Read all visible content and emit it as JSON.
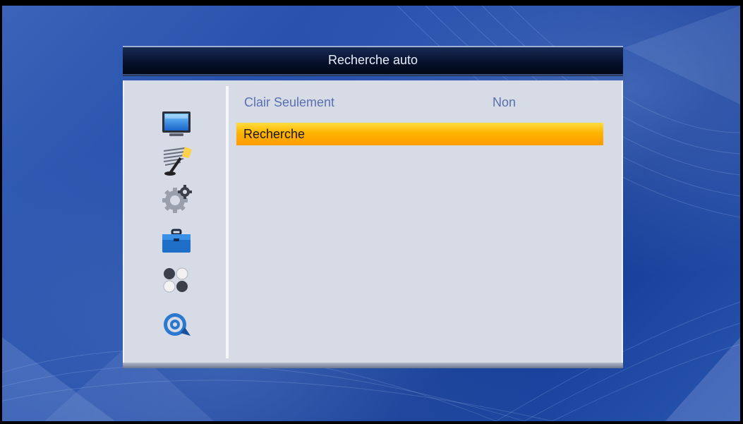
{
  "dialog": {
    "title": "Recherche auto"
  },
  "sidebar": {
    "icons": [
      {
        "name": "monitor-icon"
      },
      {
        "name": "satellite-dish-icon"
      },
      {
        "name": "settings-gear-icon"
      },
      {
        "name": "toolbox-icon"
      },
      {
        "name": "balls-icon"
      },
      {
        "name": "media-disc-icon"
      }
    ],
    "selected_index": 1
  },
  "menu": {
    "items": [
      {
        "label": "Clair Seulement",
        "value": "Non"
      },
      {
        "label": "Recherche",
        "value": ""
      }
    ],
    "selected_index": 1
  },
  "colors": {
    "highlight": "#ffb400",
    "panel": "#d6dbe6",
    "title_bar": "#07102a",
    "option_text": "#5870b0"
  }
}
